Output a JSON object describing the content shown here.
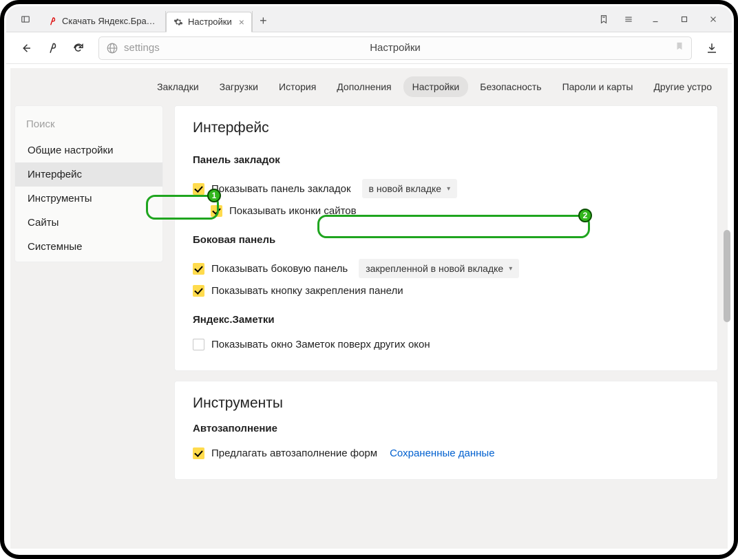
{
  "titlebar": {
    "tabs": [
      {
        "label": "Скачать Яндекс.Браузер д…"
      },
      {
        "label": "Настройки"
      }
    ]
  },
  "addressbar": {
    "url_text": "settings",
    "page_title": "Настройки"
  },
  "topnav": {
    "items": [
      "Закладки",
      "Загрузки",
      "История",
      "Дополнения",
      "Настройки",
      "Безопасность",
      "Пароли и карты",
      "Другие устро"
    ],
    "active_index": 4
  },
  "sidebar": {
    "search_placeholder": "Поиск",
    "items": [
      "Общие настройки",
      "Интерфейс",
      "Инструменты",
      "Сайты",
      "Системные"
    ],
    "active_index": 1
  },
  "sections": {
    "interface": {
      "title": "Интерфейс",
      "bookmarks_panel": {
        "heading": "Панель закладок",
        "show_panel": "Показывать панель закладок",
        "mode": "в новой вкладке",
        "show_icons": "Показывать иконки сайтов"
      },
      "side_panel": {
        "heading": "Боковая панель",
        "show_panel": "Показывать боковую панель",
        "mode": "закрепленной в новой вкладке",
        "pin_button": "Показывать кнопку закрепления панели"
      },
      "notes": {
        "heading": "Яндекс.Заметки",
        "on_top": "Показывать окно Заметок поверх других окон"
      }
    },
    "tools": {
      "title": "Инструменты",
      "autofill_heading": "Автозаполнение",
      "autofill_label": "Предлагать автозаполнение форм",
      "autofill_link": "Сохраненные данные"
    }
  },
  "annotations": {
    "one": "1",
    "two": "2"
  }
}
